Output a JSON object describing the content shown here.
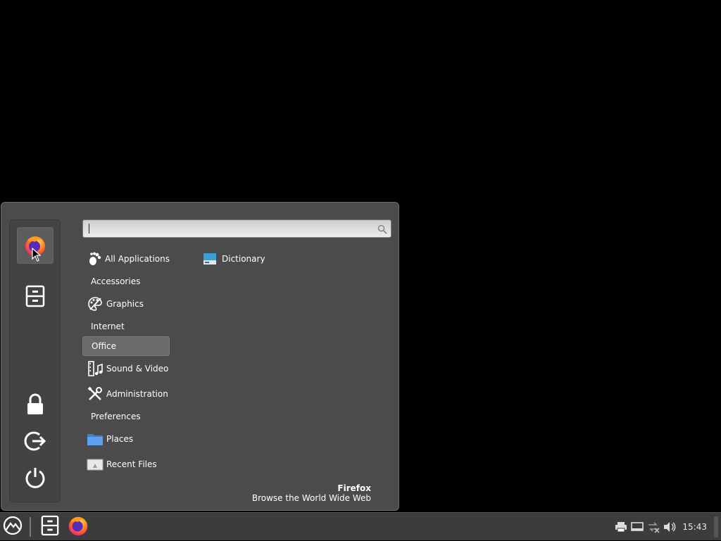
{
  "menu": {
    "search": {
      "placeholder": "",
      "value": ""
    },
    "sidebar": [
      {
        "name": "firefox-icon",
        "active": true
      },
      {
        "name": "file-manager-icon",
        "active": false
      },
      {
        "name": "lock-icon",
        "active": false
      },
      {
        "name": "logout-icon",
        "active": false
      },
      {
        "name": "power-icon",
        "active": false
      }
    ],
    "categories": [
      {
        "label": "All Applications",
        "icon": "gnome-foot-icon"
      },
      {
        "label": "Accessories",
        "icon": null
      },
      {
        "label": "Graphics",
        "icon": "palette-icon"
      },
      {
        "label": "Internet",
        "icon": null
      },
      {
        "label": "Office",
        "icon": null,
        "selected": true
      },
      {
        "label": "Sound & Video",
        "icon": "film-music-icon"
      },
      {
        "label": "Administration",
        "icon": "tools-icon"
      },
      {
        "label": "Preferences",
        "icon": null
      },
      {
        "label": "Places",
        "icon": "folder-icon"
      },
      {
        "label": "Recent Files",
        "icon": "recent-files-icon"
      }
    ],
    "apps": [
      {
        "label": "Dictionary",
        "icon": "dictionary-icon"
      }
    ],
    "description": {
      "title": "Firefox",
      "subtitle": "Browse the World Wide Web"
    }
  },
  "taskbar": {
    "launchers": [
      "menu-logo-icon",
      "file-manager-icon",
      "firefox-icon"
    ],
    "tray": [
      "printer-icon",
      "display-icon",
      "network-disconnected-icon",
      "volume-icon"
    ],
    "clock": "15:43"
  },
  "colors": {
    "menu_bg": "#4b4b4b",
    "sidebar_bg": "#434343",
    "selected_bg": "#6a6a6a",
    "taskbar_bg": "#3c3c3c",
    "desktop_bg": "#000000"
  }
}
